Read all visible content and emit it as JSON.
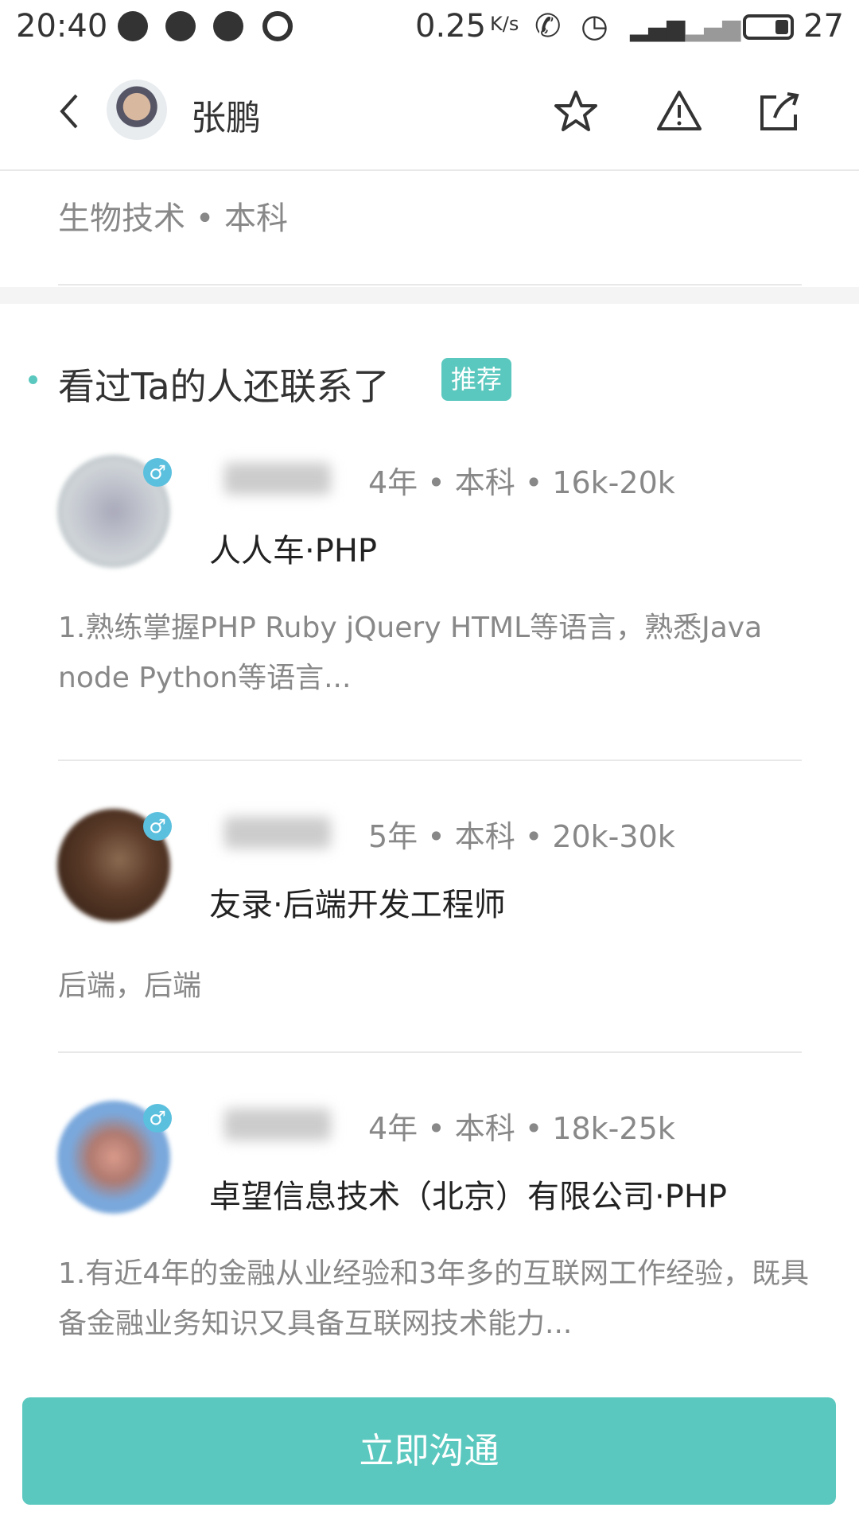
{
  "status_bar": {
    "time": "20:40",
    "speed": "0.25",
    "speed_unit": "K/s",
    "battery": "27"
  },
  "header": {
    "name": "张鹏"
  },
  "profile": {
    "education": "生物技术 • 本科"
  },
  "section": {
    "title": "看过Ta的人还联系了",
    "badge": "推荐"
  },
  "candidates": [
    {
      "meta": "4年 • 本科 • 16k-20k",
      "company": "人人车·PHP",
      "desc": "1.熟练掌握PHP Ruby jQuery HTML等语言，熟悉Java node Python等语言...",
      "gender": "♂"
    },
    {
      "meta": "5年 • 本科 • 20k-30k",
      "company": "友录·后端开发工程师",
      "desc": "后端，后端",
      "gender": "♂"
    },
    {
      "meta": "4年 • 本科 • 18k-25k",
      "company": "卓望信息技术（北京）有限公司·PHP",
      "desc": "1.有近4年的金融从业经验和3年多的互联网工作经验，既具备金融业务知识又具备互联网技术能力...",
      "gender": "♂"
    }
  ],
  "cta": {
    "label": "立即沟通"
  },
  "colors": {
    "accent": "#5ac8be"
  }
}
